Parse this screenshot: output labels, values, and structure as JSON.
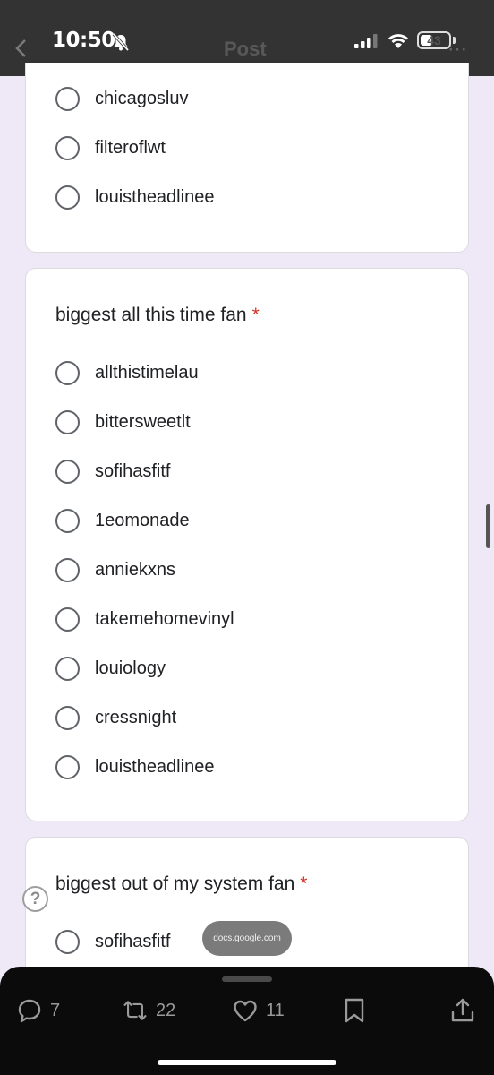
{
  "status_bar": {
    "time": "10:50",
    "battery": "43",
    "ghost_title": "Post"
  },
  "card1": {
    "options": [
      "chicagosluv",
      "filteroflwt",
      "louistheadlinee"
    ]
  },
  "card2": {
    "title": "biggest all this time fan",
    "required_mark": "*",
    "options": [
      "allthistimelau",
      "bittersweetlt",
      "sofihasfitf",
      "1eomonade",
      "anniekxns",
      "takemehomevinyl",
      "louiology",
      "cressnight",
      "louistheadlinee"
    ]
  },
  "card3": {
    "title": "biggest out of my system fan",
    "required_mark": "*",
    "options": [
      "sofihasfitf"
    ]
  },
  "help_icon": "?",
  "url_pill": "docs.google.com",
  "actions": {
    "reply_count": "7",
    "repost_count": "22",
    "like_count": "11"
  },
  "icons": {
    "reply": "reply-bubble-icon",
    "repost": "repost-icon",
    "like": "heart-icon",
    "bookmark": "bookmark-icon",
    "share": "share-icon"
  },
  "colors": {
    "background": "#efe9f7",
    "required": "#d93025",
    "status_bar": "#333333",
    "action_bar": "#0b0b0b"
  }
}
